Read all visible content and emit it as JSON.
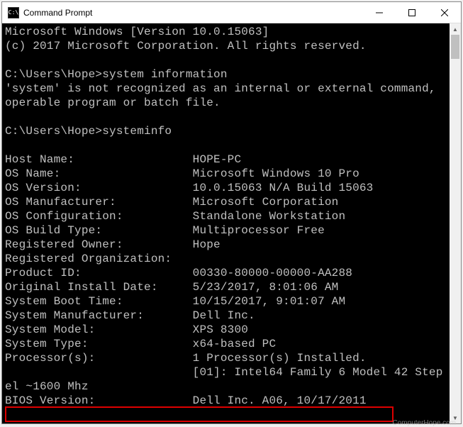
{
  "window": {
    "title": "Command Prompt",
    "icon_label": "cmd-icon"
  },
  "terminal": {
    "line1": "Microsoft Windows [Version 10.0.15063]",
    "line2": "(c) 2017 Microsoft Corporation. All rights reserved.",
    "blank1": "",
    "prompt1": "C:\\Users\\Hope>system information",
    "err1": "'system' is not recognized as an internal or external command,",
    "err2": "operable program or batch file.",
    "blank2": "",
    "prompt2": "C:\\Users\\Hope>systeminfo",
    "blank3": "",
    "info": [
      {
        "label": "Host Name:",
        "value": "HOPE-PC"
      },
      {
        "label": "OS Name:",
        "value": "Microsoft Windows 10 Pro"
      },
      {
        "label": "OS Version:",
        "value": "10.0.15063 N/A Build 15063"
      },
      {
        "label": "OS Manufacturer:",
        "value": "Microsoft Corporation"
      },
      {
        "label": "OS Configuration:",
        "value": "Standalone Workstation"
      },
      {
        "label": "OS Build Type:",
        "value": "Multiprocessor Free"
      },
      {
        "label": "Registered Owner:",
        "value": "Hope"
      },
      {
        "label": "Registered Organization:",
        "value": ""
      },
      {
        "label": "Product ID:",
        "value": "00330-80000-00000-AA288"
      },
      {
        "label": "Original Install Date:",
        "value": "5/23/2017, 8:01:06 AM"
      },
      {
        "label": "System Boot Time:",
        "value": "10/15/2017, 9:01:07 AM"
      },
      {
        "label": "System Manufacturer:",
        "value": "Dell Inc."
      },
      {
        "label": "System Model:",
        "value": "XPS 8300"
      },
      {
        "label": "System Type:",
        "value": "x64-based PC"
      },
      {
        "label": "Processor(s):",
        "value": "1 Processor(s) Installed."
      }
    ],
    "proc_line2": "                           [01]: Intel64 Family 6 Model 42 Step",
    "wrap_line": "el ~1600 Mhz",
    "bios_label": "BIOS Version:",
    "bios_value": "Dell Inc. A06, 10/17/2011",
    "label_width": 27
  },
  "watermark": "ComputerHope.com"
}
